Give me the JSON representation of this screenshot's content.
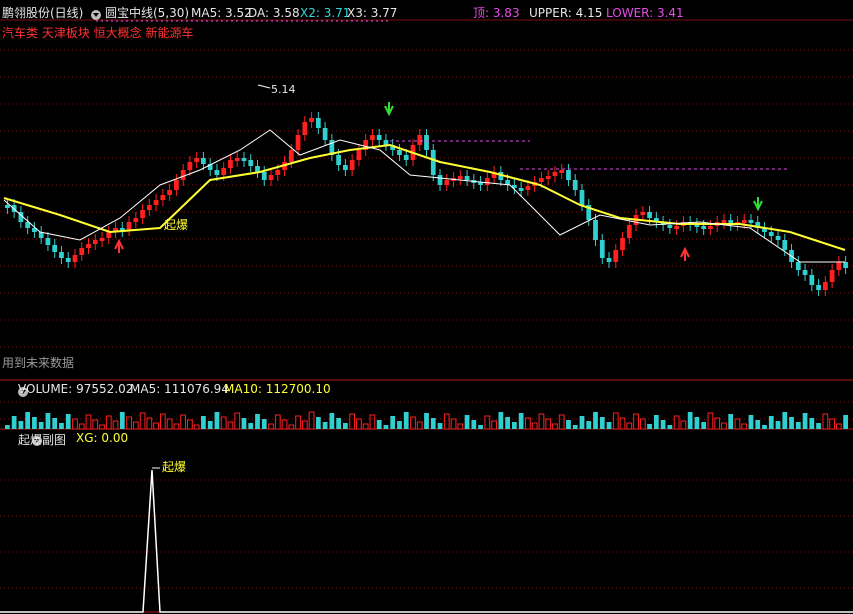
{
  "header": {
    "stock_name": "鹏翎股份(日线)",
    "indicator_name": "圆宝中线(5,30)",
    "ma5": "MA5: 3.52",
    "da": "DA: 3.58",
    "x2": "X2: 3.71",
    "x3": "X3: 3.77",
    "top": "顶: 3.83",
    "upper": "UPPER: 4.15",
    "lower": "LOWER: 3.41",
    "concepts": "汽车类 天津板块 恒大概念 新能源车"
  },
  "main_chart": {
    "high_label": "5.14",
    "signal_label": "起爆",
    "future_data_note": "用到未来数据"
  },
  "volume_panel": {
    "label": "VOLUME: 97552.02",
    "ma5": "MA5: 111076.94",
    "ma10": "MA10: 112700.10"
  },
  "sub_panel": {
    "title": "起爆副图",
    "xg": "XG: 0.00",
    "signal_label": "起爆"
  },
  "colors": {
    "up": "#ff2020",
    "down": "#30d0d0",
    "ma_line": "#ffff33",
    "grid": "#7a1010",
    "background": "#000000"
  },
  "icons": [
    "dropdown-icon"
  ]
}
